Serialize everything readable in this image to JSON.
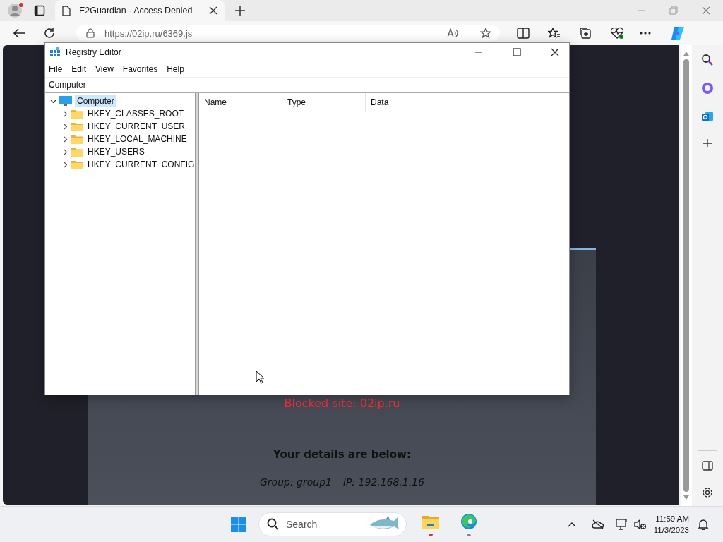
{
  "browser": {
    "tab": {
      "title": "E2Guardian - Access Denied",
      "selected": true
    },
    "address": "https://02ip.ru/6369.js"
  },
  "page": {
    "blocked": "Blocked site: 02ip.ru",
    "details_heading": "Your details are below:",
    "group": "Group: group1",
    "ip": "IP: 192.168.1.16"
  },
  "registry_editor": {
    "title": "Registry Editor",
    "menu": [
      "File",
      "Edit",
      "View",
      "Favorites",
      "Help"
    ],
    "path": "Computer",
    "tree": {
      "label": "Computer",
      "expanded": true,
      "selected": true,
      "children": [
        {
          "label": "HKEY_CLASSES_ROOT",
          "expanded": false,
          "selected": false
        },
        {
          "label": "HKEY_CURRENT_USER",
          "expanded": false,
          "selected": false
        },
        {
          "label": "HKEY_LOCAL_MACHINE",
          "expanded": false,
          "selected": false
        },
        {
          "label": "HKEY_USERS",
          "expanded": false,
          "selected": false
        },
        {
          "label": "HKEY_CURRENT_CONFIG",
          "expanded": false,
          "selected": false
        }
      ]
    },
    "columns": [
      "Name",
      "Type",
      "Data"
    ]
  },
  "taskbar": {
    "search_placeholder": "Search",
    "time": "11:59 AM",
    "date": "11/3/2023"
  }
}
